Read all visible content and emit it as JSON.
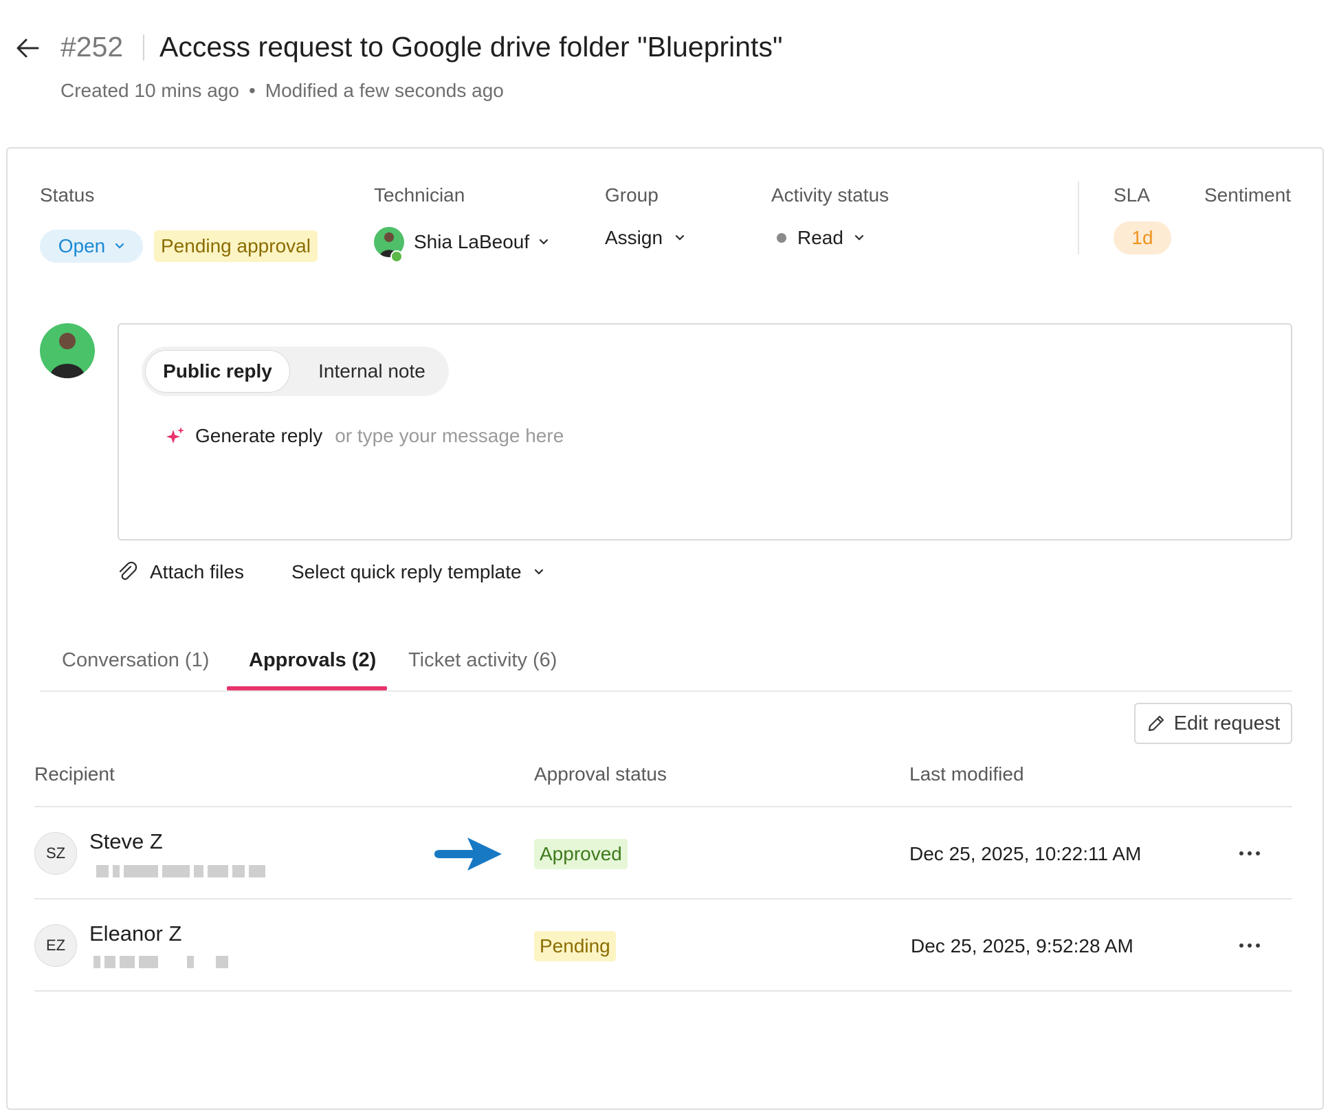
{
  "header": {
    "ticket_id": "#252",
    "title": "Access request to Google drive folder \"Blueprints\"",
    "created": "Created 10 mins ago",
    "modified": "Modified a few seconds ago",
    "meta_separator": "•"
  },
  "fields": {
    "status_label": "Status",
    "status_value": "Open",
    "status_badge": "Pending approval",
    "technician_label": "Technician",
    "technician_value": "Shia LaBeouf",
    "group_label": "Group",
    "group_value": "Assign",
    "activity_label": "Activity status",
    "activity_value": "Read",
    "sla_label": "SLA",
    "sla_value": "1d",
    "sentiment_label": "Sentiment"
  },
  "reply": {
    "tab_public": "Public reply",
    "tab_internal": "Internal note",
    "generate_label": "Generate reply",
    "placeholder": "or type your message here",
    "attach_label": "Attach files",
    "template_label": "Select quick reply template"
  },
  "tabs": [
    {
      "label": "Conversation (1)",
      "active": false
    },
    {
      "label": "Approvals (2)",
      "active": true
    },
    {
      "label": "Ticket activity (6)",
      "active": false
    }
  ],
  "actions": {
    "edit_request": "Edit request"
  },
  "table": {
    "headers": [
      "Recipient",
      "Approval status",
      "Last modified"
    ],
    "rows": [
      {
        "initials": "SZ",
        "name": "Steve Z",
        "status": "Approved",
        "last_modified": "Dec 25, 2025, 10:22:11 AM"
      },
      {
        "initials": "EZ",
        "name": "Eleanor Z",
        "status": "Pending",
        "last_modified": "Dec 25, 2025, 9:52:28 AM"
      }
    ]
  },
  "colors": {
    "accent_pink": "#e8336b",
    "open_blue": "#1a8ad4",
    "approved_green": "#3e7a1d",
    "pending_amber": "#8a6d00",
    "sla_orange": "#f0931e",
    "annotation_arrow": "#1779c4"
  },
  "icons": [
    "back-arrow-icon",
    "chevron-down-icon",
    "sparkle-icon",
    "paperclip-icon",
    "pencil-icon",
    "more-horizontal-icon",
    "annotation-arrow-icon"
  ]
}
